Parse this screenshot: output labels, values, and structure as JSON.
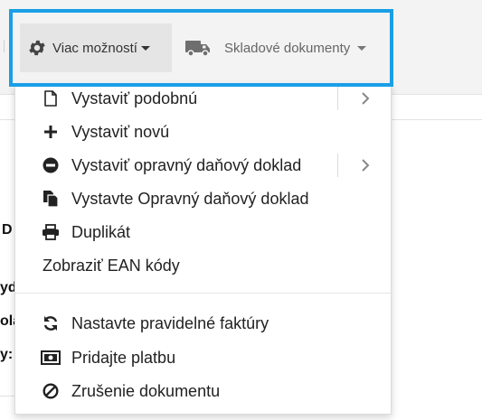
{
  "toolbar": {
    "more_label": "Viac možností",
    "stock_label": "Skladové dokumenty"
  },
  "background": {
    "texts": [
      "D",
      "yda",
      "ola",
      "y:"
    ]
  },
  "menu": {
    "items": [
      {
        "label": "Vystaviť podobnú",
        "icon": "document-icon",
        "submenu": true
      },
      {
        "label": "Vystaviť novú",
        "icon": "plus-icon",
        "submenu": false
      },
      {
        "label": "Vystaviť opravný daňový doklad",
        "icon": "minus-circle-icon",
        "submenu": true
      },
      {
        "label": "Vystavte Opravný daňový doklad",
        "icon": "copy-documents-icon",
        "submenu": false
      },
      {
        "label": "Duplikát",
        "icon": "printer-icon",
        "submenu": false
      },
      {
        "label": "Zobraziť EAN kódy",
        "icon": "",
        "submenu": false
      },
      {
        "label": "Nastavte pravidelné faktúry",
        "icon": "refresh-icon",
        "submenu": false
      },
      {
        "label": "Pridajte platbu",
        "icon": "money-icon",
        "submenu": false
      },
      {
        "label": "Zrušenie dokumentu",
        "icon": "ban-icon",
        "submenu": false
      }
    ]
  },
  "colors": {
    "highlight": "#1a9fe6",
    "toolbar_bg": "#f3f3f3",
    "active_button_bg": "#e5e5e5"
  }
}
